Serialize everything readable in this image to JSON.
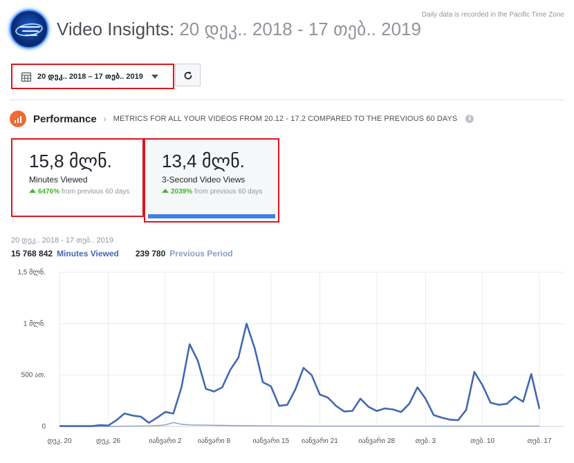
{
  "timezone_note": "Daily data is recorded in the Pacific Time Zone",
  "header": {
    "title": "Video Insights:",
    "range": "20 დეკ.. 2018 - 17 თებ.. 2019"
  },
  "date_picker": {
    "label": "20 დეკ.. 2018 – 17 თებ.. 2019"
  },
  "performance": {
    "title": "Performance",
    "subtitle": "METRICS FOR ALL YOUR VIDEOS FROM 20.12 - 17.2 COMPARED TO THE PREVIOUS 60 DAYS"
  },
  "cards": [
    {
      "value": "15,8 მლნ.",
      "name": "Minutes Viewed",
      "pct": "6476%",
      "suffix": "from previous 60 days"
    },
    {
      "value": "13,4 მლნ.",
      "name": "3-Second Video Views",
      "pct": "2039%",
      "suffix": "from previous 60 days"
    }
  ],
  "chart_header": {
    "range": "20 დეკ.. 2018 - 17 თებ.. 2019",
    "current_total": "15 768 842",
    "current_label": "Minutes Viewed",
    "previous_total": "239 780",
    "previous_label": "Previous Period"
  },
  "colors": {
    "current": "#4267b2",
    "previous": "#8b9dc3",
    "accent": "#e0131d"
  },
  "chart_data": {
    "type": "line",
    "y_ticks": [
      "0",
      "500 ათ.",
      "1 მლნ.",
      "1,5 მლნ."
    ],
    "y_tick_values": [
      0,
      500000,
      1000000,
      1500000
    ],
    "ylim": [
      0,
      1500000
    ],
    "x_tick_labels": [
      "დეკ. 20",
      "დეკ. 26",
      "იანვარი 2",
      "იანვარი 8",
      "იანვარი 15",
      "იანვარი 21",
      "იანვარი 28",
      "თებ. 3",
      "თებ. 10",
      "თებ. 17"
    ],
    "x_tick_days": [
      0,
      6,
      13,
      19,
      26,
      32,
      39,
      45,
      52,
      59
    ],
    "grid": true,
    "series": [
      {
        "name": "Minutes Viewed",
        "values": [
          3000,
          3000,
          3000,
          3000,
          3000,
          12000,
          8000,
          60000,
          125000,
          105000,
          95000,
          35000,
          85000,
          140000,
          125000,
          380000,
          800000,
          640000,
          365000,
          340000,
          380000,
          550000,
          670000,
          1000000,
          760000,
          430000,
          390000,
          200000,
          210000,
          360000,
          570000,
          500000,
          310000,
          280000,
          200000,
          145000,
          150000,
          270000,
          190000,
          150000,
          175000,
          165000,
          140000,
          220000,
          380000,
          270000,
          110000,
          85000,
          65000,
          60000,
          160000,
          530000,
          400000,
          230000,
          210000,
          220000,
          290000,
          240000,
          510000,
          170000
        ]
      },
      {
        "name": "Previous Period",
        "values": [
          0,
          0,
          0,
          0,
          0,
          0,
          0,
          0,
          2000,
          3000,
          4000,
          5000,
          8000,
          14000,
          38000,
          20000,
          15000,
          13000,
          12000,
          11000,
          10000,
          9000,
          8000,
          7000,
          6000,
          5000,
          5000,
          4000,
          4000,
          4000,
          4000,
          3000,
          3000,
          3000,
          3000,
          3000,
          3000,
          3000,
          3000,
          3000,
          3000,
          3000,
          3000,
          3000,
          3000,
          3000,
          3000,
          3000,
          3000,
          3000,
          3000,
          3000,
          3000,
          3000,
          3000,
          3000,
          3000,
          3000,
          3000,
          3000
        ]
      }
    ]
  }
}
